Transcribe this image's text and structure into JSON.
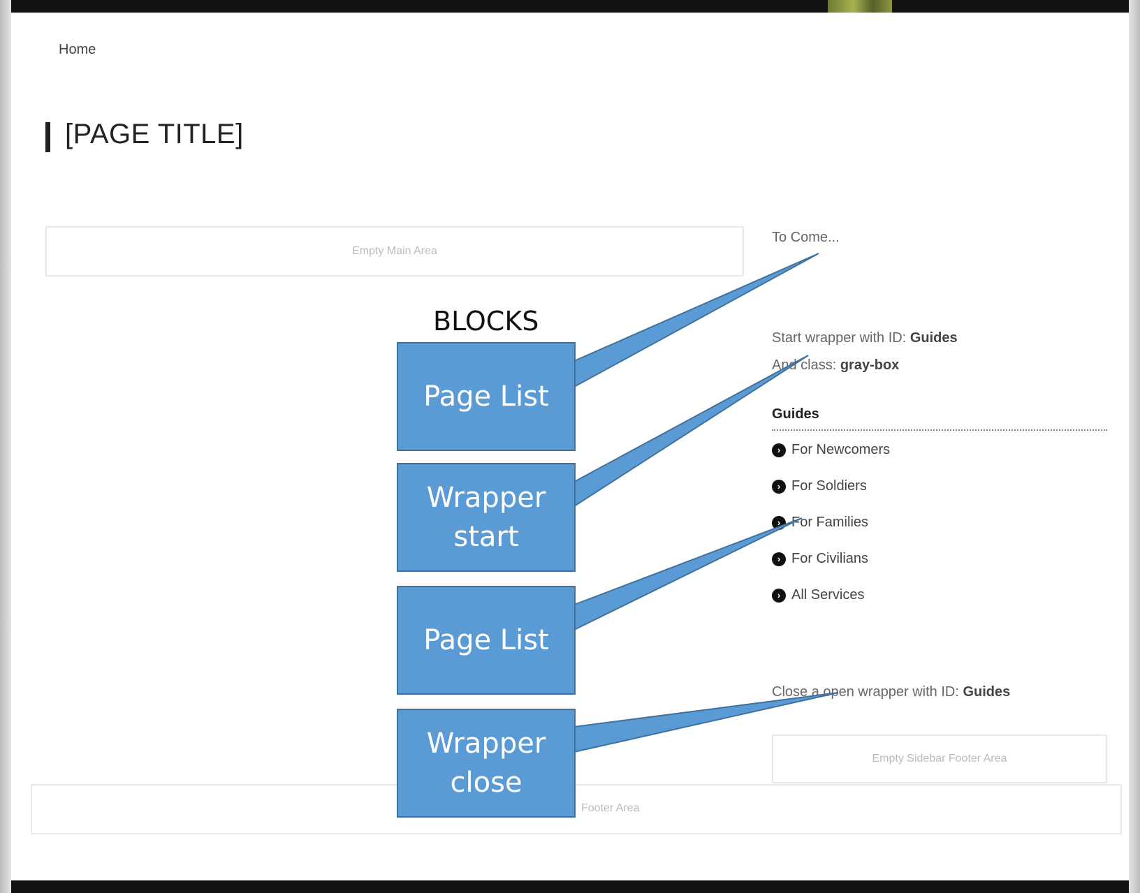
{
  "breadcrumb": "Home",
  "page_title": "[PAGE TITLE]",
  "main_area_label": "Empty Main Area",
  "sidebar": {
    "to_come": "To Come...",
    "wrapper_start_prefix": "Start wrapper with ID: ",
    "wrapper_start_id": "Guides",
    "wrapper_class_prefix": "And class: ",
    "wrapper_class": "gray-box",
    "guides_heading": "Guides",
    "links": [
      {
        "label": "For Newcomers"
      },
      {
        "label": "For Soldiers"
      },
      {
        "label": "For Families"
      },
      {
        "label": "For Civilians"
      },
      {
        "label": "All Services"
      }
    ],
    "link_icon": "chevron-circle-right-icon",
    "close_wrapper_prefix": "Close a open wrapper with ID: ",
    "close_wrapper_id": "Guides",
    "footer_area_label": "Empty Sidebar Footer Area"
  },
  "footer_area_label": "Footer Area",
  "annotation": {
    "heading": "BLOCKS",
    "blocks": [
      {
        "label": "Page List"
      },
      {
        "label": "Wrapper start"
      },
      {
        "label": "Page List"
      },
      {
        "label": "Wrapper close"
      }
    ],
    "color": "#5b9bd5",
    "border_color": "#41719c"
  }
}
